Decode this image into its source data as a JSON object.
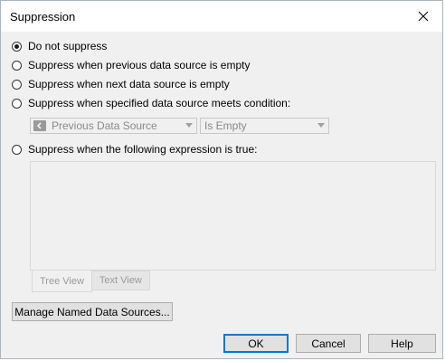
{
  "window": {
    "title": "Suppression"
  },
  "options": {
    "do_not_suppress": "Do not suppress",
    "previous_empty": "Suppress when previous data source is empty",
    "next_empty": "Suppress when next data source is empty",
    "specified_condition": "Suppress when specified data source meets condition:",
    "expression_true": "Suppress when the following expression is true:",
    "selected": "do_not_suppress"
  },
  "condition": {
    "data_source": "Previous Data Source",
    "operator": "Is Empty"
  },
  "expression_tabs": {
    "tree_view": "Tree View",
    "text_view": "Text View"
  },
  "buttons": {
    "manage": "Manage Named Data Sources...",
    "ok": "OK",
    "cancel": "Cancel",
    "help": "Help"
  }
}
